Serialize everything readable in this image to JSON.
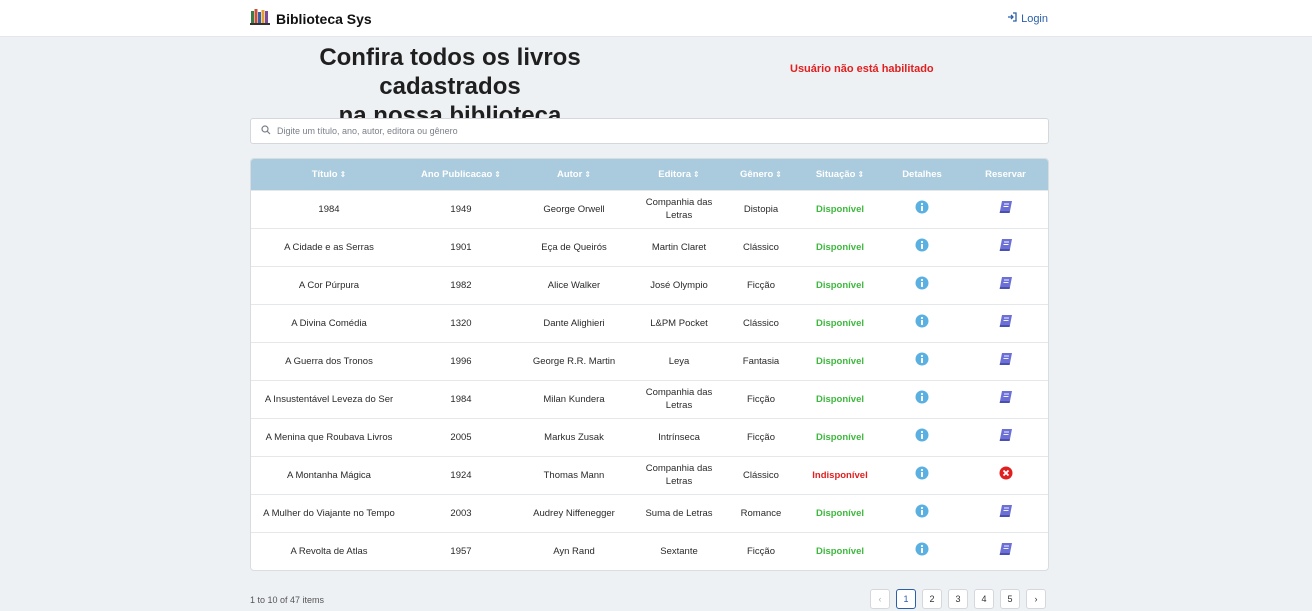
{
  "navbar": {
    "brand": "Biblioteca Sys",
    "login": "Login"
  },
  "headline": {
    "line1": "Confira todos os livros cadastrados",
    "line2": "na nossa biblioteca"
  },
  "status_warning": "Usuário não está habilitado",
  "search": {
    "placeholder": "Digite um título, ano, autor, editora ou gênero",
    "value": ""
  },
  "table": {
    "headers": [
      "Título",
      "Ano Publicacao",
      "Autor",
      "Editora",
      "Gênero",
      "Situação",
      "Detalhes",
      "Reservar"
    ],
    "sort_icon": "⇕",
    "rows": [
      {
        "titulo": "1984",
        "ano": "1949",
        "autor": "George Orwell",
        "editora": "Companhia das Letras",
        "genero": "Distopia",
        "situacao": "Disponível",
        "available": true
      },
      {
        "titulo": "A Cidade e as Serras",
        "ano": "1901",
        "autor": "Eça de Queirós",
        "editora": "Martin Claret",
        "genero": "Clássico",
        "situacao": "Disponível",
        "available": true
      },
      {
        "titulo": "A Cor Púrpura",
        "ano": "1982",
        "autor": "Alice Walker",
        "editora": "José Olympio",
        "genero": "Ficção",
        "situacao": "Disponível",
        "available": true
      },
      {
        "titulo": "A Divina Comédia",
        "ano": "1320",
        "autor": "Dante Alighieri",
        "editora": "L&PM Pocket",
        "genero": "Clássico",
        "situacao": "Disponível",
        "available": true
      },
      {
        "titulo": "A Guerra dos Tronos",
        "ano": "1996",
        "autor": "George R.R. Martin",
        "editora": "Leya",
        "genero": "Fantasia",
        "situacao": "Disponível",
        "available": true
      },
      {
        "titulo": "A Insustentável Leveza do Ser",
        "ano": "1984",
        "autor": "Milan Kundera",
        "editora": "Companhia das Letras",
        "genero": "Ficção",
        "situacao": "Disponível",
        "available": true
      },
      {
        "titulo": "A Menina que Roubava Livros",
        "ano": "2005",
        "autor": "Markus Zusak",
        "editora": "Intrínseca",
        "genero": "Ficção",
        "situacao": "Disponível",
        "available": true
      },
      {
        "titulo": "A Montanha Mágica",
        "ano": "1924",
        "autor": "Thomas Mann",
        "editora": "Companhia das Letras",
        "genero": "Clássico",
        "situacao": "Indisponível",
        "available": false
      },
      {
        "titulo": "A Mulher do Viajante no Tempo",
        "ano": "2003",
        "autor": "Audrey Niffenegger",
        "editora": "Suma de Letras",
        "genero": "Romance",
        "situacao": "Disponível",
        "available": true
      },
      {
        "titulo": "A Revolta de Atlas",
        "ano": "1957",
        "autor": "Ayn Rand",
        "editora": "Sextante",
        "genero": "Ficção",
        "situacao": "Disponível",
        "available": true
      }
    ]
  },
  "footer": {
    "count": "1 to 10 of 47 items"
  },
  "pagination": {
    "prev": "‹",
    "next": "›",
    "pages": [
      "1",
      "2",
      "3",
      "4",
      "5"
    ],
    "current": "1"
  },
  "colors": {
    "available": "#3fb83f",
    "unavailable": "#e02020",
    "header_bg": "#a9cbdd",
    "info_icon": "#5ab0e0",
    "book_icon": "#6b6fd6"
  },
  "icons": {
    "details": "info-circle-icon",
    "reserve": "book-icon",
    "reserve_disabled": "x-circle-icon",
    "search": "search-icon",
    "login": "sign-in-icon",
    "brand": "bookshelf-icon"
  }
}
